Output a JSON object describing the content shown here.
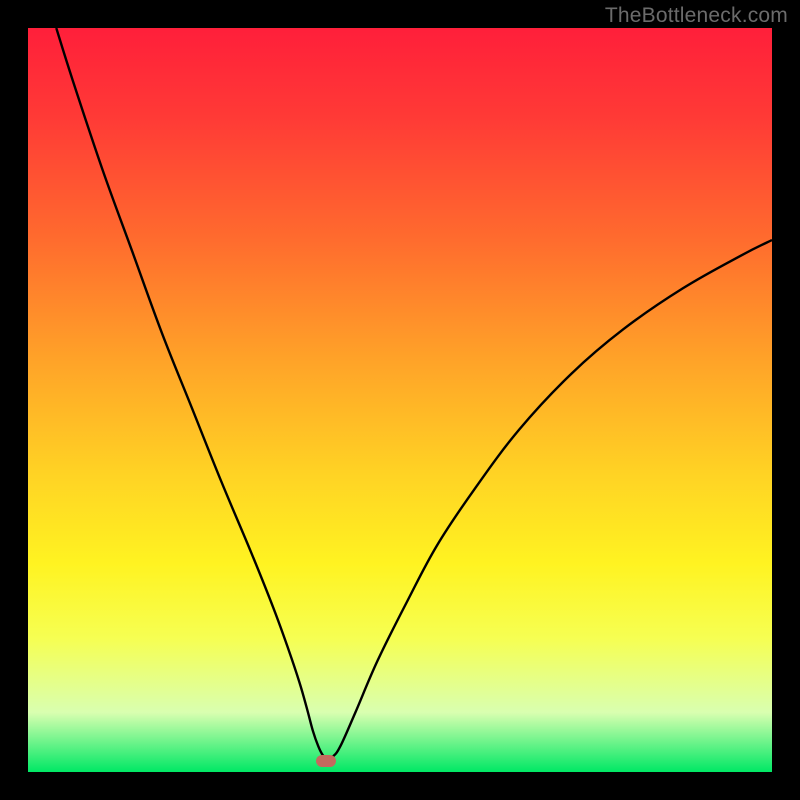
{
  "watermark": "TheBottleneck.com",
  "colors": {
    "marker": "#c46a5e"
  },
  "chart_data": {
    "type": "line",
    "title": "",
    "xlabel": "",
    "ylabel": "",
    "x_range": [
      0,
      100
    ],
    "y_range": [
      0,
      100
    ],
    "series": [
      {
        "name": "bottleneck-curve",
        "x": [
          3.8,
          6,
          10,
          14,
          18,
          22,
          26,
          30,
          33,
          35,
          36.5,
          37.5,
          38.3,
          39,
          39.6,
          40.2,
          41,
          42,
          44,
          47,
          51,
          55,
          60,
          66,
          73,
          80,
          88,
          96,
          100
        ],
        "y": [
          100,
          93,
          81,
          70,
          59,
          49,
          39,
          29.5,
          22,
          16.5,
          12,
          8.5,
          5.5,
          3.5,
          2.3,
          1.8,
          2.1,
          3.5,
          8,
          15,
          23,
          30.5,
          38,
          46,
          53.5,
          59.5,
          65,
          69.5,
          71.5
        ]
      }
    ],
    "minimum_marker": {
      "x": 40,
      "y": 1.5
    },
    "notes": "V-shaped bottleneck percentage curve over a red-to-green vertical gradient; minimum near x≈40."
  }
}
